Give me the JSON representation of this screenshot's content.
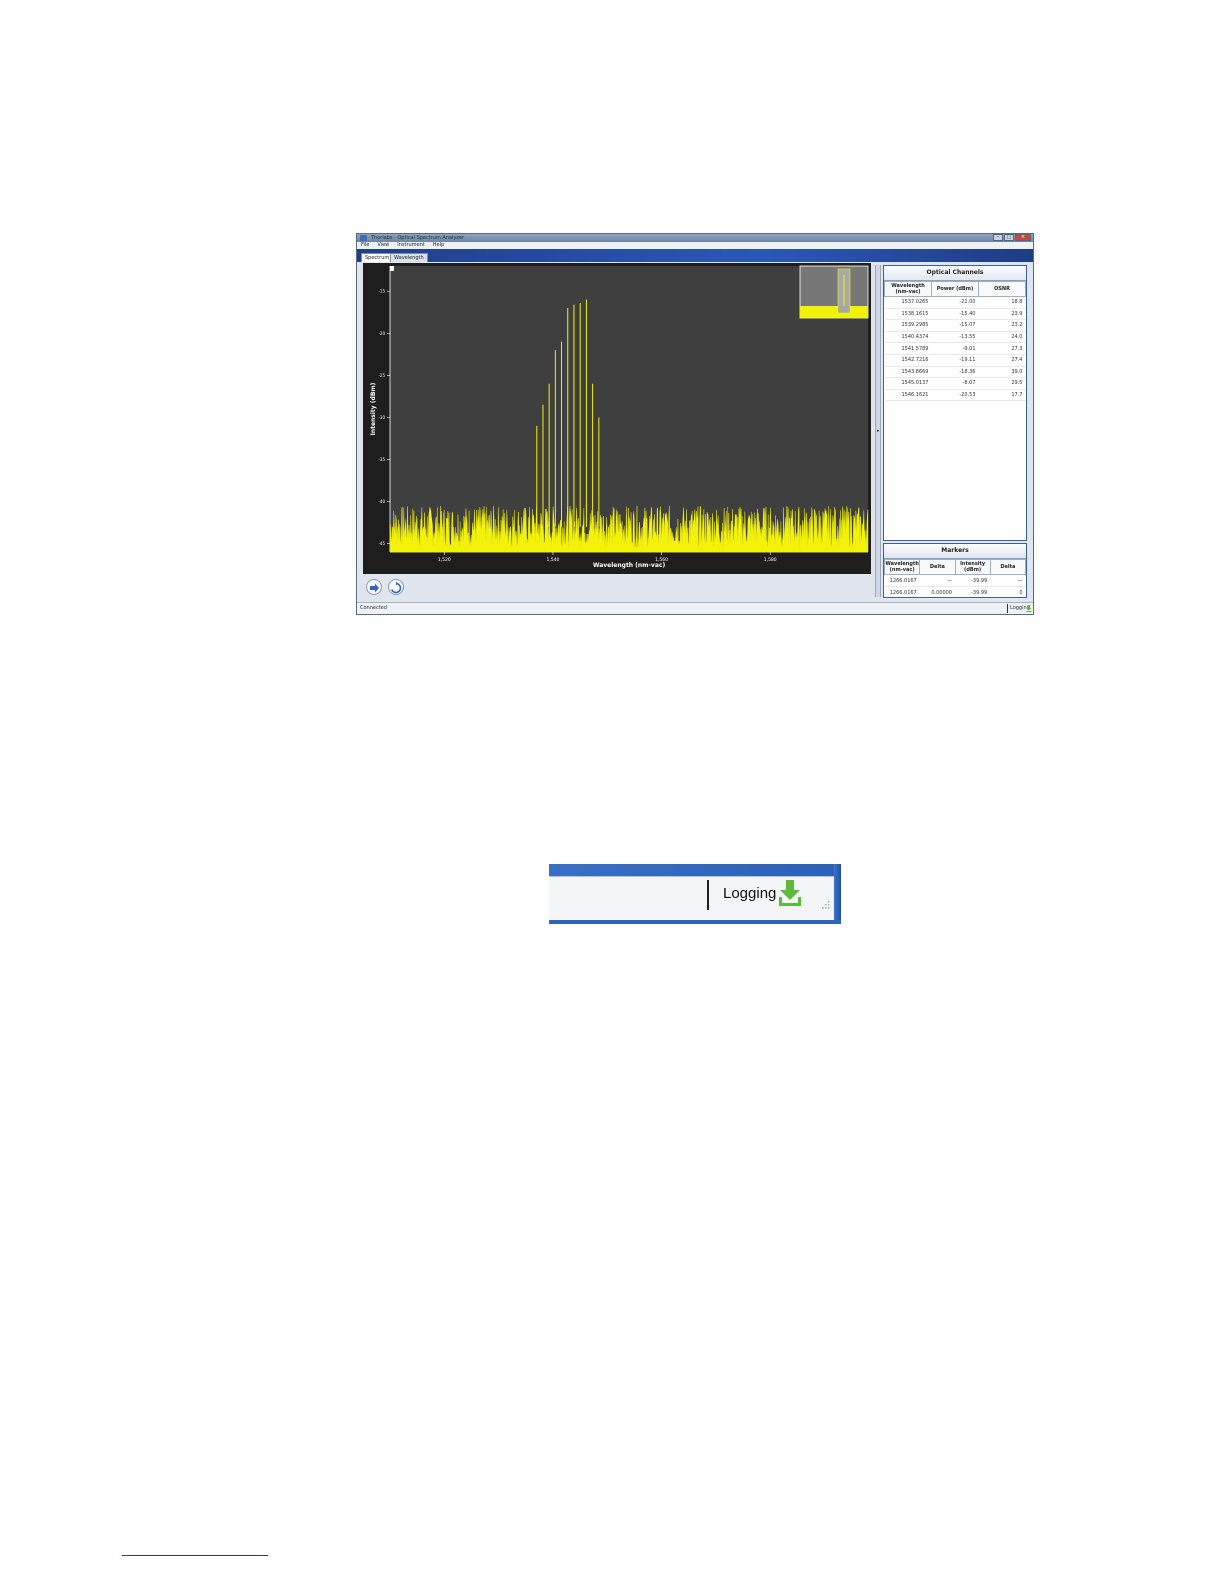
{
  "window": {
    "title": "Thorlabs · Optical Spectrum Analyzer",
    "menu": [
      "File",
      "View",
      "Instrument",
      "Help"
    ],
    "tabs": [
      "Spectrum",
      "Wavelength"
    ]
  },
  "chart_data": {
    "type": "line",
    "xlabel": "Wavelength (nm-vac)",
    "ylabel": "Intensity (dBm)",
    "xlim": [
      1510,
      1598
    ],
    "ylim": [
      -46,
      -12
    ],
    "x_ticks": [
      "1,520",
      "1,540",
      "1,560",
      "1,580"
    ],
    "y_ticks": [
      "-15",
      "-20",
      "-25",
      "-30",
      "-35",
      "-40",
      "-45"
    ],
    "noise_floor": -43,
    "peaks": [
      {
        "x": 1537.0265,
        "y": -31.0
      },
      {
        "x": 1538.1615,
        "y": -28.5
      },
      {
        "x": 1539.2985,
        "y": -26.0
      },
      {
        "x": 1540.4374,
        "y": -22.0
      },
      {
        "x": 1541.5789,
        "y": -21.0
      },
      {
        "x": 1542.7216,
        "y": -17.0
      },
      {
        "x": 1543.8669,
        "y": -16.6
      },
      {
        "x": 1545.0137,
        "y": -16.4
      },
      {
        "x": 1546.1621,
        "y": -16.0
      },
      {
        "x": 1547.3,
        "y": -26.0
      },
      {
        "x": 1548.45,
        "y": -30.0
      }
    ],
    "color": "#f2f20a",
    "background": "#3f3f3f"
  },
  "optical_channels": {
    "title": "Optical Channels",
    "headers": [
      "Wavelength (nm-vac)",
      "Power (dBm)",
      "OSNR"
    ],
    "rows": [
      [
        "1537.0265",
        "-21.00",
        "18.8"
      ],
      [
        "1538.1615",
        "-15.40",
        "23.9"
      ],
      [
        "1539.2985",
        "-15.07",
        "23.2"
      ],
      [
        "1540.4374",
        "-13.55",
        "24.0"
      ],
      [
        "1541.5789",
        "-9.01",
        "27.3"
      ],
      [
        "1542.7216",
        "-19.11",
        "27.4"
      ],
      [
        "1543.8669",
        "-18.36",
        "39.0"
      ],
      [
        "1545.0137",
        "-8.07",
        "29.5"
      ],
      [
        "1546.1621",
        "-20.53",
        "17.7"
      ]
    ]
  },
  "markers": {
    "title": "Markers",
    "headers": [
      "Wavelength (nm-vac)",
      "Delta",
      "Intensity (dBm)",
      "Delta"
    ],
    "rows": [
      [
        "1266.0167",
        "—",
        "-39.99",
        "—"
      ],
      [
        "1266.0167",
        "0.00000",
        "-39.99",
        "0"
      ]
    ]
  },
  "status": {
    "left": "Connected",
    "logging": "Logging"
  },
  "zoom": {
    "logging": "Logging"
  },
  "colors": {
    "accent": "#2b58b8",
    "trace": "#f2f20a",
    "logging_icon": "#5dbb3a"
  }
}
